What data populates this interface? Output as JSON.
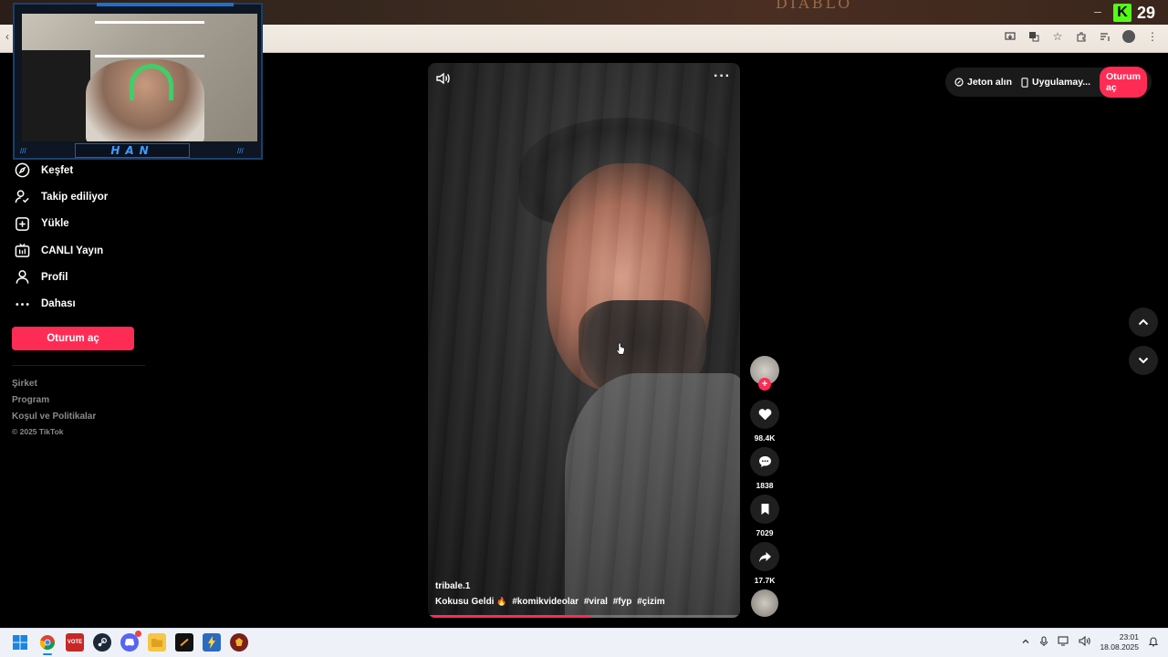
{
  "banner": {
    "title": "DIABLO",
    "kick_count": "29"
  },
  "webcam": {
    "name": "HAN"
  },
  "sidebar": {
    "items": [
      {
        "label": "Keşfet",
        "icon": "compass-icon"
      },
      {
        "label": "Takip ediliyor",
        "icon": "user-follow-icon"
      },
      {
        "label": "Yükle",
        "icon": "upload-plus-icon"
      },
      {
        "label": "CANLI Yayın",
        "icon": "live-tv-icon"
      },
      {
        "label": "Profil",
        "icon": "profile-icon"
      },
      {
        "label": "Dahası",
        "icon": "more-dots-icon"
      }
    ],
    "login_label": "Oturum aç",
    "footer": {
      "links": [
        "Şirket",
        "Program",
        "Koşul ve Politikalar"
      ],
      "copyright": "© 2025 TikTok"
    }
  },
  "top_actions": {
    "coins_label": "Jeton alın",
    "app_label": "Uygulamay...",
    "login_label": "Oturum aç"
  },
  "video": {
    "author": "tribale.1",
    "caption_text": "Kokusu Geldi",
    "caption_emoji": "🔥",
    "hashtags": [
      "#komikvideolar",
      "#viral",
      "#fyp",
      "#çizim"
    ],
    "progress": 0.52
  },
  "actions": {
    "likes": "98.4K",
    "comments": "1838",
    "saves": "7029",
    "shares": "17.7K"
  },
  "taskbar": {
    "time": "23:01",
    "date": "18.08.2025"
  },
  "colors": {
    "accent": "#fe2c55",
    "kick": "#53fc18"
  }
}
